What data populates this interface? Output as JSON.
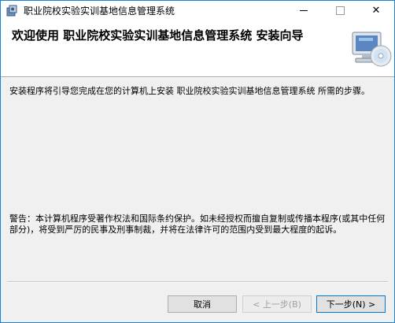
{
  "window": {
    "title": "职业院校实验实训基地信息管理系统",
    "minimize_glyph": "",
    "maximize_glyph": "",
    "close_glyph": "✕"
  },
  "header": {
    "title": "欢迎使用 职业院校实验实训基地信息管理系统 安装向导"
  },
  "body": {
    "intro": "安装程序将引导您完成在您的计算机上安装 职业院校实验实训基地信息管理系统 所需的步骤。",
    "warning": "警告：本计算机程序受著作权法和国际条约保护。如未经授权而擅自复制或传播本程序(或其中任何部分)，将受到严厉的民事及刑事制裁，并将在法律许可的范围内受到最大程度的起诉。"
  },
  "buttons": {
    "cancel": "取消",
    "back": "< 上一步(B)",
    "next": "下一步(N) >"
  },
  "icons": {
    "app": "installer-app-icon",
    "header": "computer-cd-icon"
  },
  "colors": {
    "accent": "#0078d7",
    "window_border": "#1883d7",
    "panel": "#f0f0f0",
    "disabled_text": "#a0a0a0"
  }
}
